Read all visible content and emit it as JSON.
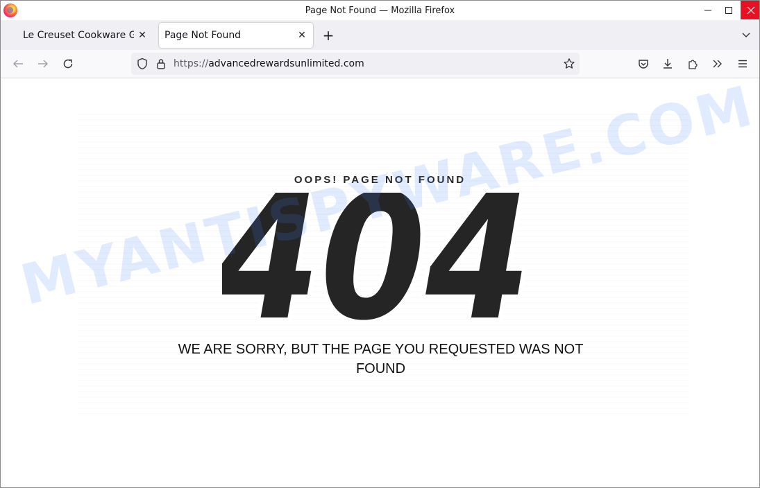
{
  "window": {
    "title": "Page Not Found — Mozilla Firefox"
  },
  "tabs": [
    {
      "label": "Le Creuset Cookware Giv",
      "active": false
    },
    {
      "label": "Page Not Found",
      "active": true
    }
  ],
  "toolbar": {
    "url_protocol": "https://",
    "url_host": "advancedrewardsunlimited.com"
  },
  "page": {
    "oops_text": "OOPS! PAGE NOT FOUND",
    "error_code": "404",
    "sorry_text": "WE ARE SORRY, BUT THE PAGE YOU REQUESTED WAS NOT FOUND"
  },
  "watermark": "MYANTISPYWARE.COM",
  "colors": {
    "accent_close": "#e81123",
    "text_dark": "#262626",
    "watermark": "#4682ff"
  }
}
